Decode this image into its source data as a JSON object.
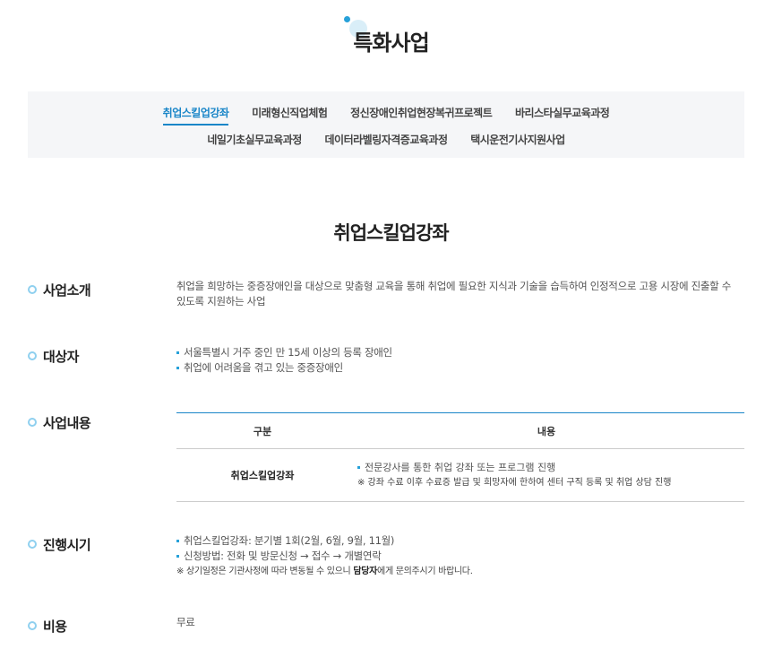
{
  "page_title": "특화사업",
  "tabs": {
    "row1": [
      "취업스킬업강좌",
      "미래형신직업체험",
      "정신장애인취업현장복귀프로젝트",
      "바리스타실무교육과정"
    ],
    "row2": [
      "네일기초실무교육과정",
      "데이터라벨링자격증교육과정",
      "택시운전기사지원사업"
    ],
    "active": "취업스킬업강좌"
  },
  "section_title": "취업스킬업강좌",
  "intro": {
    "label": "사업소개",
    "text_line1": "취업을 희망하는 중증장애인을 대상으로 맞춤형 교육을 통해 취업에 필요한 지식과 기술을 습득하여 인정적으로 고용 시장에 진출할 수",
    "text_line2": "있도록 지원하는 사업"
  },
  "target": {
    "label": "대상자",
    "items": [
      "서울특별시 거주 중인 만 15세 이상의 등록 장애인",
      "취업에 어려움을 겪고 있는 중증장애인"
    ]
  },
  "contents": {
    "label": "사업내용",
    "table": {
      "headers": [
        "구분",
        "내용"
      ],
      "row_key": "취업스킬업강좌",
      "row_item": "전문강사를 통한 취업 강좌 또는 프로그램 진행",
      "row_note": "※ 강좌 수료 이후 수료증 발급 및 희망자에 한하여 센터 구직 등록 및 취업 상담 진행"
    }
  },
  "schedule": {
    "label": "진행시기",
    "items": [
      "취업스킬업강좌: 분기별 1회(2월, 6월, 9월, 11월)",
      "신청방법: 전화 및 방문신청 → 접수 → 개별연락"
    ],
    "note_prefix": "※ 상기일정은 기관사정에 따라 변동될 수 있으니 ",
    "note_bold": "담당자",
    "note_suffix": "에게 문의주시기 바랍니다."
  },
  "cost": {
    "label": "비용",
    "value": "무료"
  }
}
